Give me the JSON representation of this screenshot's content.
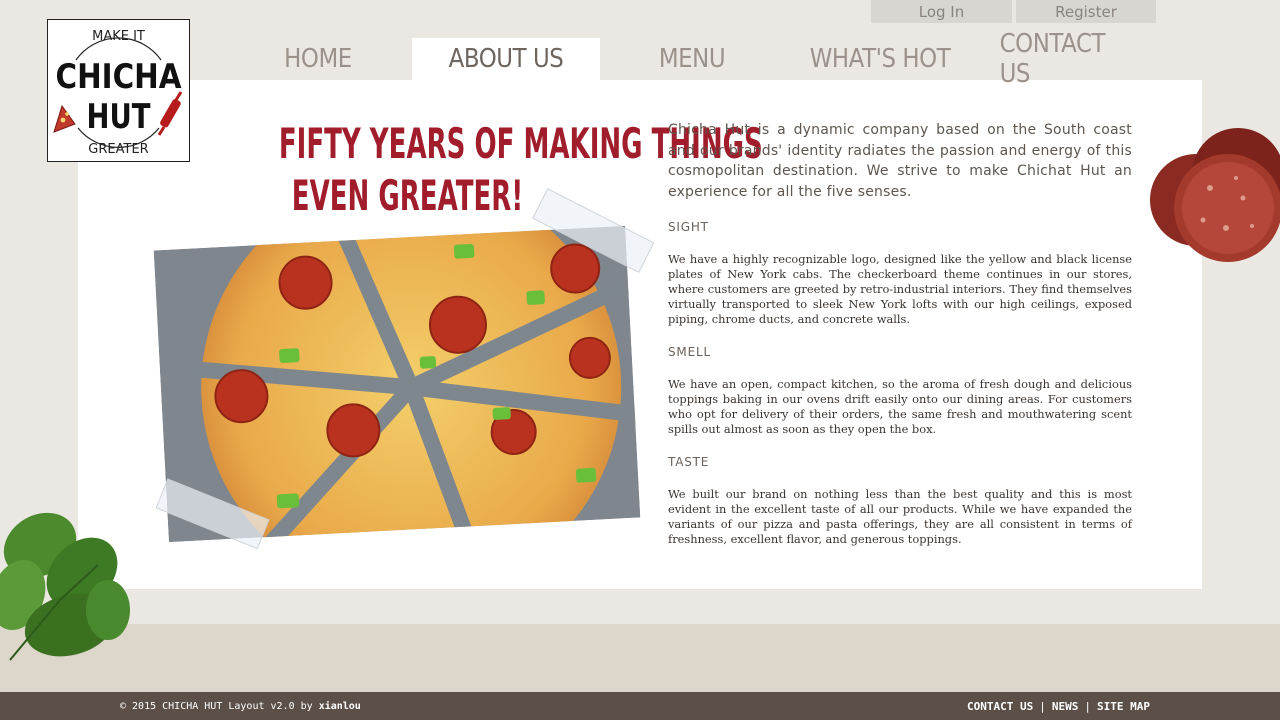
{
  "auth": {
    "login_label": "Log In",
    "register_label": "Register"
  },
  "nav": {
    "items": [
      {
        "label": "HOME"
      },
      {
        "label": "ABOUT US"
      },
      {
        "label": "MENU"
      },
      {
        "label": "WHAT'S HOT"
      },
      {
        "label": "CONTACT US"
      }
    ],
    "active": "ABOUT US"
  },
  "logo": {
    "top_text": "MAKE IT",
    "line1": "CHICHA",
    "line2": "HUT",
    "bottom_text": "GREATER"
  },
  "headline": {
    "line1": "FIFTY YEARS OF MAKING THINGS",
    "line2": "EVEN GREATER!"
  },
  "intro": "Chicha Hut is a dynamic company based on the South coast and our brands' identity radiates the passion and energy of this cosmopolitan destination. We strive to make Chichat Hut an experience for all the five senses.",
  "sections": [
    {
      "title": "SIGHT",
      "body": "We have a highly recognizable logo, designed like the yellow and black license plates of New York cabs. The checkerboard theme continues in our stores, where customers are greeted by retro-industrial interiors. They find themselves virtually transported to sleek New York lofts with our high ceilings, exposed piping, chrome ducts, and concrete walls."
    },
    {
      "title": "SMELL",
      "body": "We have an open, compact kitchen, so the aroma of fresh dough and delicious toppings baking in our ovens drift easily onto our dining areas. For customers who opt for delivery of their orders, the same fresh and mouthwatering scent spills out almost as soon as they open the box."
    },
    {
      "title": "TASTE",
      "body": "We built our brand on nothing less than the best quality and this is most evident in the excellent taste of all our products. While we have expanded the variants of our pizza and pasta offerings, they are all consistent in terms of freshness, excellent flavor, and generous toppings."
    }
  ],
  "footer": {
    "copyright_prefix": "© 2015 CHICHA HUT Layout v2.0 by ",
    "author": "xianlou",
    "links": [
      "CONTACT US",
      "NEWS",
      "SITE MAP"
    ],
    "separator": "|"
  },
  "colors": {
    "accent": "#a11d2b",
    "footer_bg": "#5b4f47",
    "page_bg": "#ebe8e3"
  }
}
